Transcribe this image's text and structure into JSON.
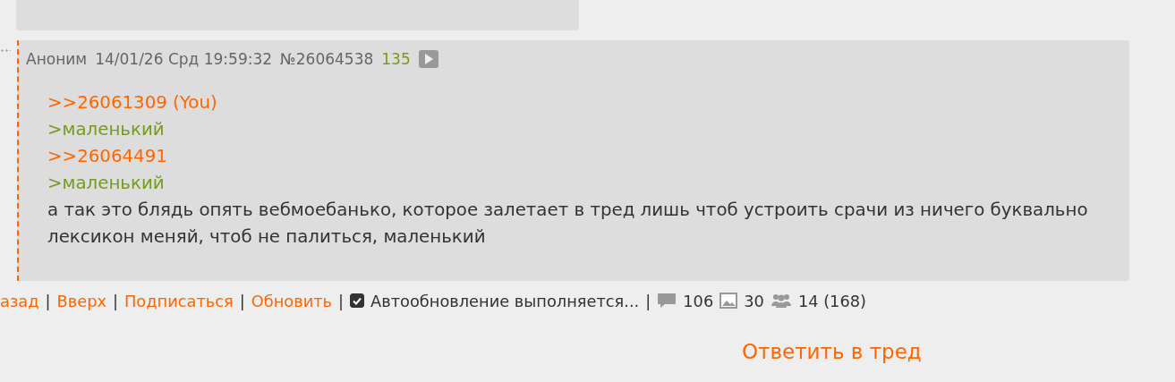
{
  "post": {
    "name": "Аноним",
    "date": "14/01/26 Срд 19:59:32",
    "number": "№26064538",
    "index": "135",
    "lines": [
      {
        "kind": "reply",
        "text": ">>26061309 (You)"
      },
      {
        "kind": "quote",
        "text": ">маленький"
      },
      {
        "kind": "reply",
        "text": ">>26064491"
      },
      {
        "kind": "quote",
        "text": ">маленький"
      },
      {
        "kind": "text",
        "text": "а так это блядь опять вебмоебанько, которое залетает в тред лишь чтоб устроить срачи из ничего буквально"
      },
      {
        "kind": "text",
        "text": "лексикон меняй, чтоб не палиться, маленький"
      }
    ]
  },
  "footer": {
    "separator": "|",
    "links": [
      "азад",
      "Вверх",
      "Подписаться",
      "Обновить"
    ],
    "autoupdate": {
      "checked": true,
      "label": "Автообновление выполняется..."
    },
    "stats": [
      {
        "kind": "posts",
        "text": "106"
      },
      {
        "kind": "images",
        "text": "30"
      },
      {
        "kind": "users",
        "text": "14 (168)"
      }
    ]
  },
  "reply_link": "Ответить в тред"
}
